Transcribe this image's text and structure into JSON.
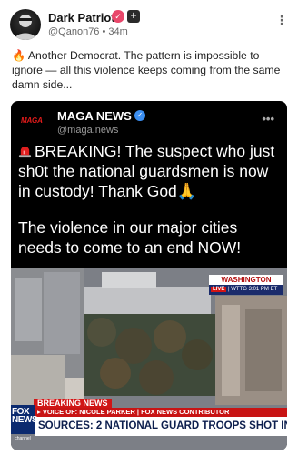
{
  "post": {
    "author_name": "Dark Patriot",
    "handle_line": "@Qanon76 • 34m",
    "text": "🔥 Another Democrat. The pattern is impossible to ignore — all this violence keeps coming from the same damn side...",
    "badge_plus": "+"
  },
  "repost": {
    "logo_text": "MAGA",
    "name": "MAGA NEWS",
    "handle": "@maga.news",
    "headline": "BREAKING! The suspect who just sh0t the national guardsmen is now in custody! Thank God🙏",
    "subline": "The violence in our major cities needs to come to an end NOW!"
  },
  "broadcast": {
    "location": "WASHINGTON",
    "live_label": "LIVE",
    "live_info": "| WTTG  3:01 PM ET",
    "breaking_label": "BREAKING NEWS",
    "voice_line": "▸ VOICE OF: NICOLE PARKER | FOX NEWS CONTRIBUTOR",
    "network_logo": "FOX NEWS",
    "network_sub": "channel",
    "ticker_headline": "SOURCES: 2 NATIONAL GUARD TROOPS SHOT IN DC"
  },
  "colors": {
    "accent_badge": "#e8476a",
    "verified_blue": "#3b8ef0",
    "breaking_red": "#d01616",
    "fox_blue": "#0b2a6f"
  }
}
